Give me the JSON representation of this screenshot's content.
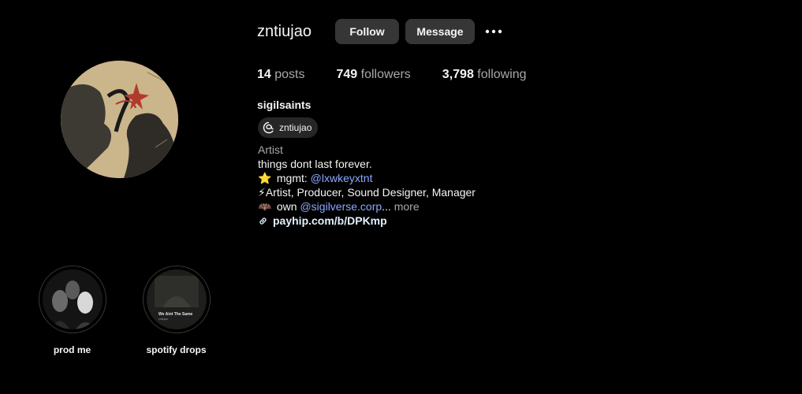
{
  "profile": {
    "username": "zntiujao",
    "follow_label": "Follow",
    "message_label": "Message",
    "full_name": "sigilsaints",
    "threads_handle": "zntiujao"
  },
  "stats": [
    {
      "num": "14",
      "label": "posts"
    },
    {
      "num": "749",
      "label": "followers"
    },
    {
      "num": "3,798",
      "label": "following"
    }
  ],
  "bio": {
    "category": "Artist",
    "line1": "things dont last forever.",
    "line2_emoji": "⭐",
    "line2_prefix": "mgmt:",
    "line2_mention": "@lxwkeyxtnt",
    "line3": "⚡Artist, Producer, Sound Designer, Manager",
    "line4_emoji": "🦇",
    "line4_prefix": "own",
    "line4_mention": "@sigilverse.corp",
    "line4_ellipsis": "...",
    "line4_more": "more",
    "link": "payhip.com/b/DPKmp"
  },
  "highlights": [
    {
      "label": "prod me"
    },
    {
      "label": "spotify drops",
      "cover_title": "We Aint The Same",
      "cover_sub": "zntiujao"
    }
  ],
  "colors": {
    "background": "#000000",
    "button": "#363636",
    "mention": "#8aa8ff",
    "muted": "#a8a8a8"
  }
}
